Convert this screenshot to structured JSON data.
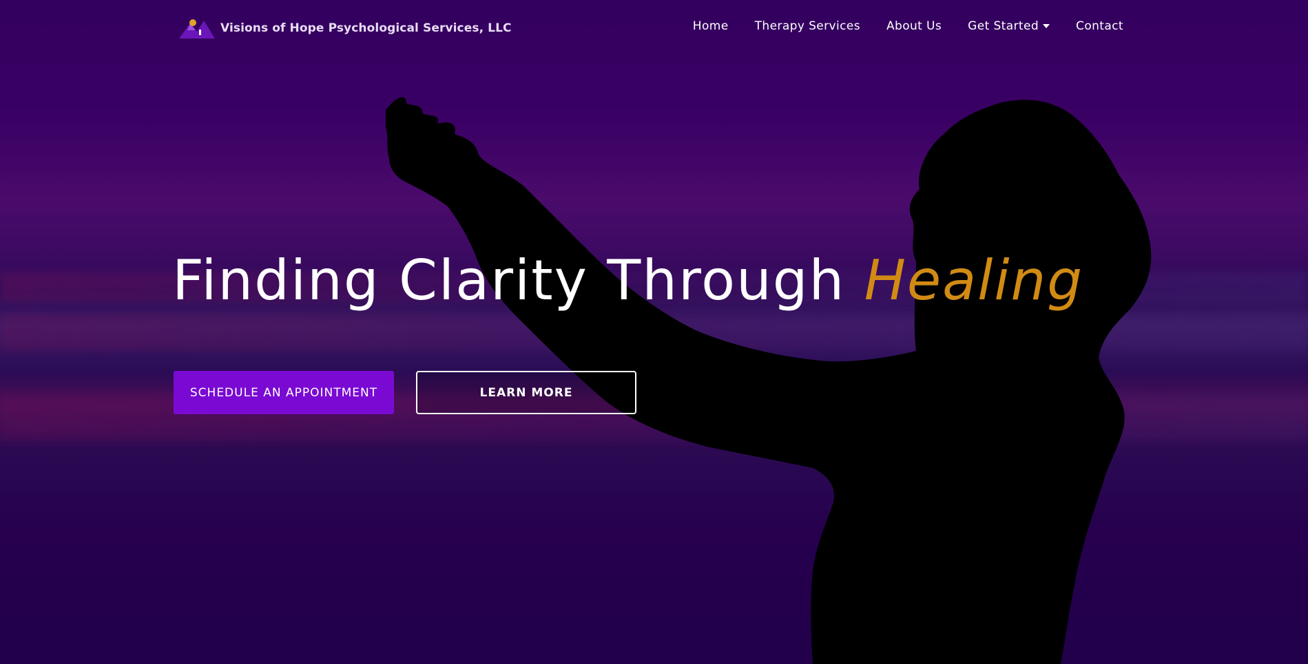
{
  "brand": {
    "name": "Visions of Hope Psychological Services, LLC",
    "logo_icon": "mountain-logo-icon"
  },
  "nav": {
    "items": [
      {
        "label": "Home"
      },
      {
        "label": "Therapy Services"
      },
      {
        "label": "About Us"
      },
      {
        "label": "Get Started",
        "has_dropdown": true
      },
      {
        "label": "Contact"
      }
    ]
  },
  "hero": {
    "title_main": "Finding Clarity Through",
    "title_accent": "Healing",
    "accent_color": "#d18b14"
  },
  "buttons": {
    "primary_label": "SCHEDULE AN APPOINTMENT",
    "primary_color": "#7a0ad3",
    "secondary_label": "LEARN MORE"
  },
  "colors": {
    "background": "#2a0057",
    "text": "#ffffff"
  }
}
